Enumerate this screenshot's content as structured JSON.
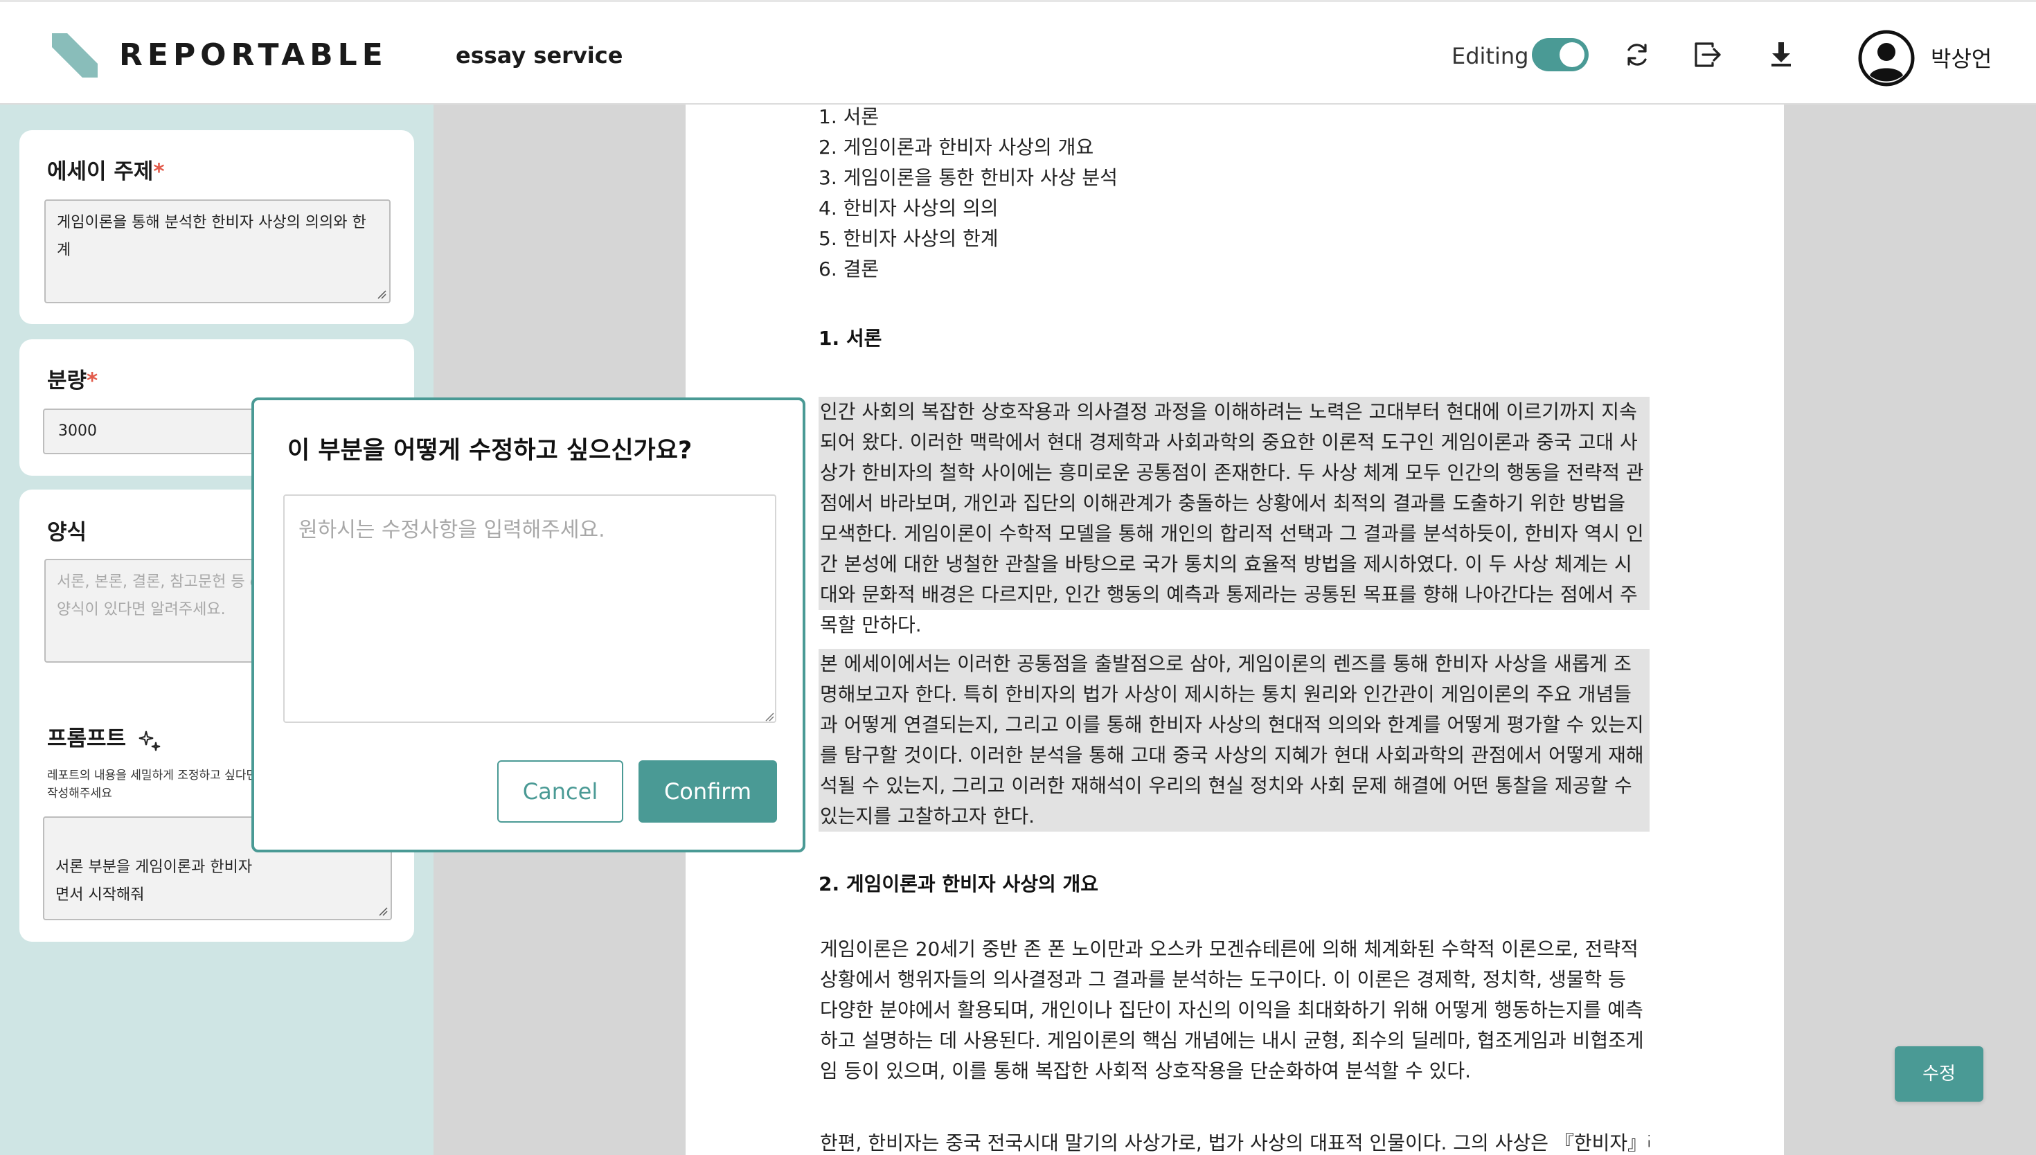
{
  "header": {
    "brand": "REPORTABLE",
    "service": "essay service",
    "editing_label": "Editing",
    "editing_on": true,
    "username": "박상언",
    "icons": [
      "refresh-icon",
      "export-icon",
      "download-icon",
      "user-icon"
    ]
  },
  "left": {
    "topic": {
      "title": "에세이 주제",
      "required_mark": "*",
      "value": "게임이론을 통해 분석한 한비자 사상의 의의와 한계"
    },
    "amount": {
      "title": "분량",
      "required_mark": "*",
      "value": "3000"
    },
    "format": {
      "title": "양식",
      "placeholder": "서론, 본론, 결론, 참고문헌 등 d\n양식이 있다면 알려주세요."
    },
    "prompt": {
      "title": "프롬프트",
      "hint": "레포트의 내용을 세밀하게 조정하고 싶다면\n작성해주세요",
      "value": "서론 부분을 게임이론과 한비자\n면서 시작해줘"
    }
  },
  "document": {
    "toc": [
      "1. 서론",
      "2. 게임이론과 한비자 사상의 개요",
      "3. 게임이론을 통한 한비자 사상 분석",
      "4. 한비자 사상의 의의",
      "5. 한비자 사상의 한계",
      "6. 결론"
    ],
    "section1_title": "1. 서론",
    "p1": "인간 사회의 복잡한 상호작용과 의사결정 과정을 이해하려는 노력은 고대부터 현대에 이르기까지 지속되어 왔다. 이러한 맥락에서 현대 경제학과 사회과학의 중요한 이론적 도구인 게임이론과 중국 고대 사상가 한비자의 철학 사이에는 흥미로운 공통점이 존재한다. 두 사상 체계 모두 인간의 행동을 전략적 관점에서 바라보며, 개인과 집단의 이해관계가 충돌하는 상황에서 최적의 결과를 도출하기 위한 방법을 모색한다. 게임이론이 수학적 모델을 통해 개인의 합리적 선택과 그 결과를 분석하듯이, 한비자 역시 인간 본성에 대한 냉철한 관찰을 바탕으로 국가 통치의 효율적 방법을 제시하였다. 이 두 사상 체계는 시대와 문화적 배경은 다르지만, 인간 행동의 예측과 통제라는 공통된 목표를 향해 나아간다는 점에서 주목할 만하다.",
    "p2": "본 에세이에서는 이러한 공통점을 출발점으로 삼아, 게임이론의 렌즈를 통해 한비자 사상을 새롭게 조명해보고자 한다. 특히 한비자의 법가 사상이 제시하는 통치 원리와 인간관이 게임이론의 주요 개념들과 어떻게 연결되는지, 그리고 이를 통해 한비자 사상의 현대적 의의와 한계를 어떻게 평가할 수 있는지를 탐구할 것이다. 이러한 분석을 통해 고대 중국 사상의 지혜가 현대 사회과학의 관점에서 어떻게 재해석될 수 있는지, 그리고 이러한 재해석이 우리의 현실 정치와 사회 문제 해결에 어떤 통찰을 제공할 수 있는지를 고찰하고자 한다.",
    "section2_title": "2. 게임이론과 한비자 사상의 개요",
    "p3": "게임이론은 20세기 중반 존 폰 노이만과 오스카 모겐슈테른에 의해 체계화된 수학적 이론으로, 전략적 상황에서 행위자들의 의사결정과 그 결과를 분석하는 도구이다. 이 이론은 경제학, 정치학, 생물학 등 다양한 분야에서 활용되며, 개인이나 집단이 자신의 이익을 최대화하기 위해 어떻게 행동하는지를 예측하고 설명하는 데 사용된다. 게임이론의 핵심 개념에는 내시 균형, 죄수의 딜레마, 협조게임과 비협조게임 등이 있으며, 이를 통해 복잡한 사회적 상호작용을 단순화하여 분석할 수 있다.",
    "p4": "한편, 한비자는 중국 전국시대 말기의 사상가로, 법가 사상의 대표적 인물이다. 그의 사상은 『한비자』라는"
  },
  "fab_label": "수정",
  "modal": {
    "title": "이 부분을 어떻게 수정하고 싶으신가요?",
    "placeholder": "원하시는 수정사항을 입력해주세요.",
    "cancel": "Cancel",
    "confirm": "Confirm"
  },
  "colors": {
    "accent": "#4a9a95",
    "left_bg": "#cfe5e4",
    "highlight": "#e2e2e2"
  }
}
